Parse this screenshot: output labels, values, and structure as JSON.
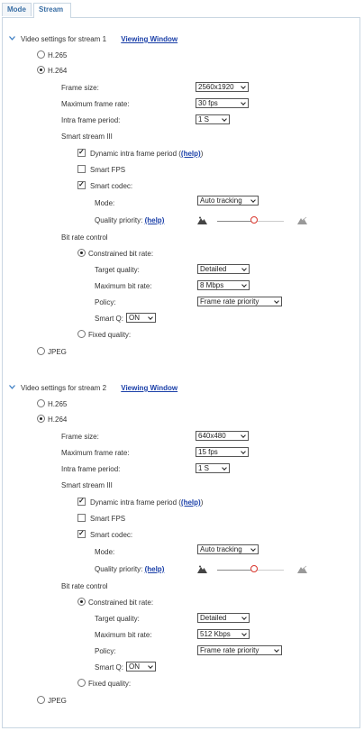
{
  "tabs": [
    {
      "label": "Mode"
    },
    {
      "label": "Stream"
    }
  ],
  "streams": [
    {
      "title": "Video settings for stream 1",
      "viewing_window": "Viewing Window",
      "h265": "H.265",
      "h264": "H.264",
      "frame_size_label": "Frame size:",
      "frame_size_value": "2560x1920",
      "max_frame_rate_label": "Maximum frame rate:",
      "max_frame_rate_value": "30 fps",
      "intra_label": "Intra frame period:",
      "intra_value": "1 S",
      "smart_stream": "Smart stream III",
      "dynamic_intra": "Dynamic intra frame period (",
      "help": "(help)",
      "close_paren": ")",
      "smart_fps": "Smart FPS",
      "smart_codec": "Smart codec:",
      "mode_label": "Mode:",
      "mode_value": "Auto tracking",
      "quality_priority_label": "Quality priority: ",
      "bitrate_control": "Bit rate control",
      "constrained": "Constrained bit rate:",
      "target_quality_label": "Target quality:",
      "target_quality_value": "Detailed",
      "max_bitrate_label": "Maximum bit rate:",
      "max_bitrate_value": "8 Mbps",
      "policy_label": "Policy:",
      "policy_value": "Frame rate priority",
      "smart_q_label": "Smart Q:",
      "smart_q_value": "ON",
      "fixed_quality": "Fixed quality:",
      "jpeg": "JPEG",
      "checked": {
        "dynamic_intra": true,
        "smart_fps": false,
        "smart_codec": true
      },
      "codec": "H.264",
      "rate_mode": "constrained",
      "quality_priority": 0.55
    },
    {
      "title": "Video settings for stream 2",
      "viewing_window": "Viewing Window",
      "h265": "H.265",
      "h264": "H.264",
      "frame_size_label": "Frame size:",
      "frame_size_value": "640x480",
      "max_frame_rate_label": "Maximum frame rate:",
      "max_frame_rate_value": "15 fps",
      "intra_label": "Intra frame period:",
      "intra_value": "1 S",
      "smart_stream": "Smart stream III",
      "dynamic_intra": "Dynamic intra frame period (",
      "help": "(help)",
      "close_paren": ")",
      "smart_fps": "Smart FPS",
      "smart_codec": "Smart codec:",
      "mode_label": "Mode:",
      "mode_value": "Auto tracking",
      "quality_priority_label": "Quality priority: ",
      "bitrate_control": "Bit rate control",
      "constrained": "Constrained bit rate:",
      "target_quality_label": "Target quality:",
      "target_quality_value": "Detailed",
      "max_bitrate_label": "Maximum bit rate:",
      "max_bitrate_value": "512 Kbps",
      "policy_label": "Policy:",
      "policy_value": "Frame rate priority",
      "smart_q_label": "Smart Q:",
      "smart_q_value": "ON",
      "fixed_quality": "Fixed quality:",
      "jpeg": "JPEG",
      "checked": {
        "dynamic_intra": true,
        "smart_fps": false,
        "smart_codec": true
      },
      "codec": "H.264",
      "rate_mode": "constrained",
      "quality_priority": 0.55
    }
  ],
  "colors": {
    "link": "#1a3fa8",
    "accent": "#3a7cc2",
    "knob": "#d9342b"
  }
}
